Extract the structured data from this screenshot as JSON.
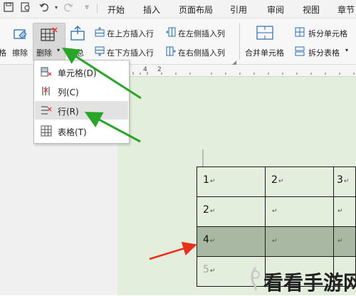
{
  "menubar": {
    "tabs": [
      "开始",
      "插入",
      "页面布局",
      "引用",
      "审阅",
      "视图",
      "章节"
    ]
  },
  "ribbon": {
    "partial_left": "格",
    "erase_label": "擦除",
    "delete_label": "删除",
    "summary_label": "汇总",
    "insert_above": "在上方插入行",
    "insert_below": "在下方插入行",
    "insert_left": "在左侧插入列",
    "insert_right": "在右侧插入列",
    "merge_cells": "合并单元格",
    "split_cells": "拆分单元格",
    "split_table": "拆分表格"
  },
  "dropdown": {
    "items": [
      {
        "label": "单元格(D)"
      },
      {
        "label": "列(C)"
      },
      {
        "label": "行(R)"
      },
      {
        "label": "表格(T)"
      }
    ]
  },
  "ruler": {
    "marks": [
      "4",
      "2"
    ]
  },
  "table": {
    "rows": [
      [
        "1",
        "2",
        "3"
      ],
      [
        "2",
        "",
        ""
      ],
      [
        "4",
        "",
        ""
      ],
      [
        "5",
        "",
        ""
      ]
    ],
    "return_mark": "↵"
  },
  "watermark": {
    "text": "看看手游网"
  },
  "colors": {
    "doc_background": "#e3efdc",
    "selected_row": "#a9b8a2",
    "arrow_green": "#2aa52a",
    "arrow_red": "#e8301c",
    "delete_icon_red": "#e04040"
  }
}
